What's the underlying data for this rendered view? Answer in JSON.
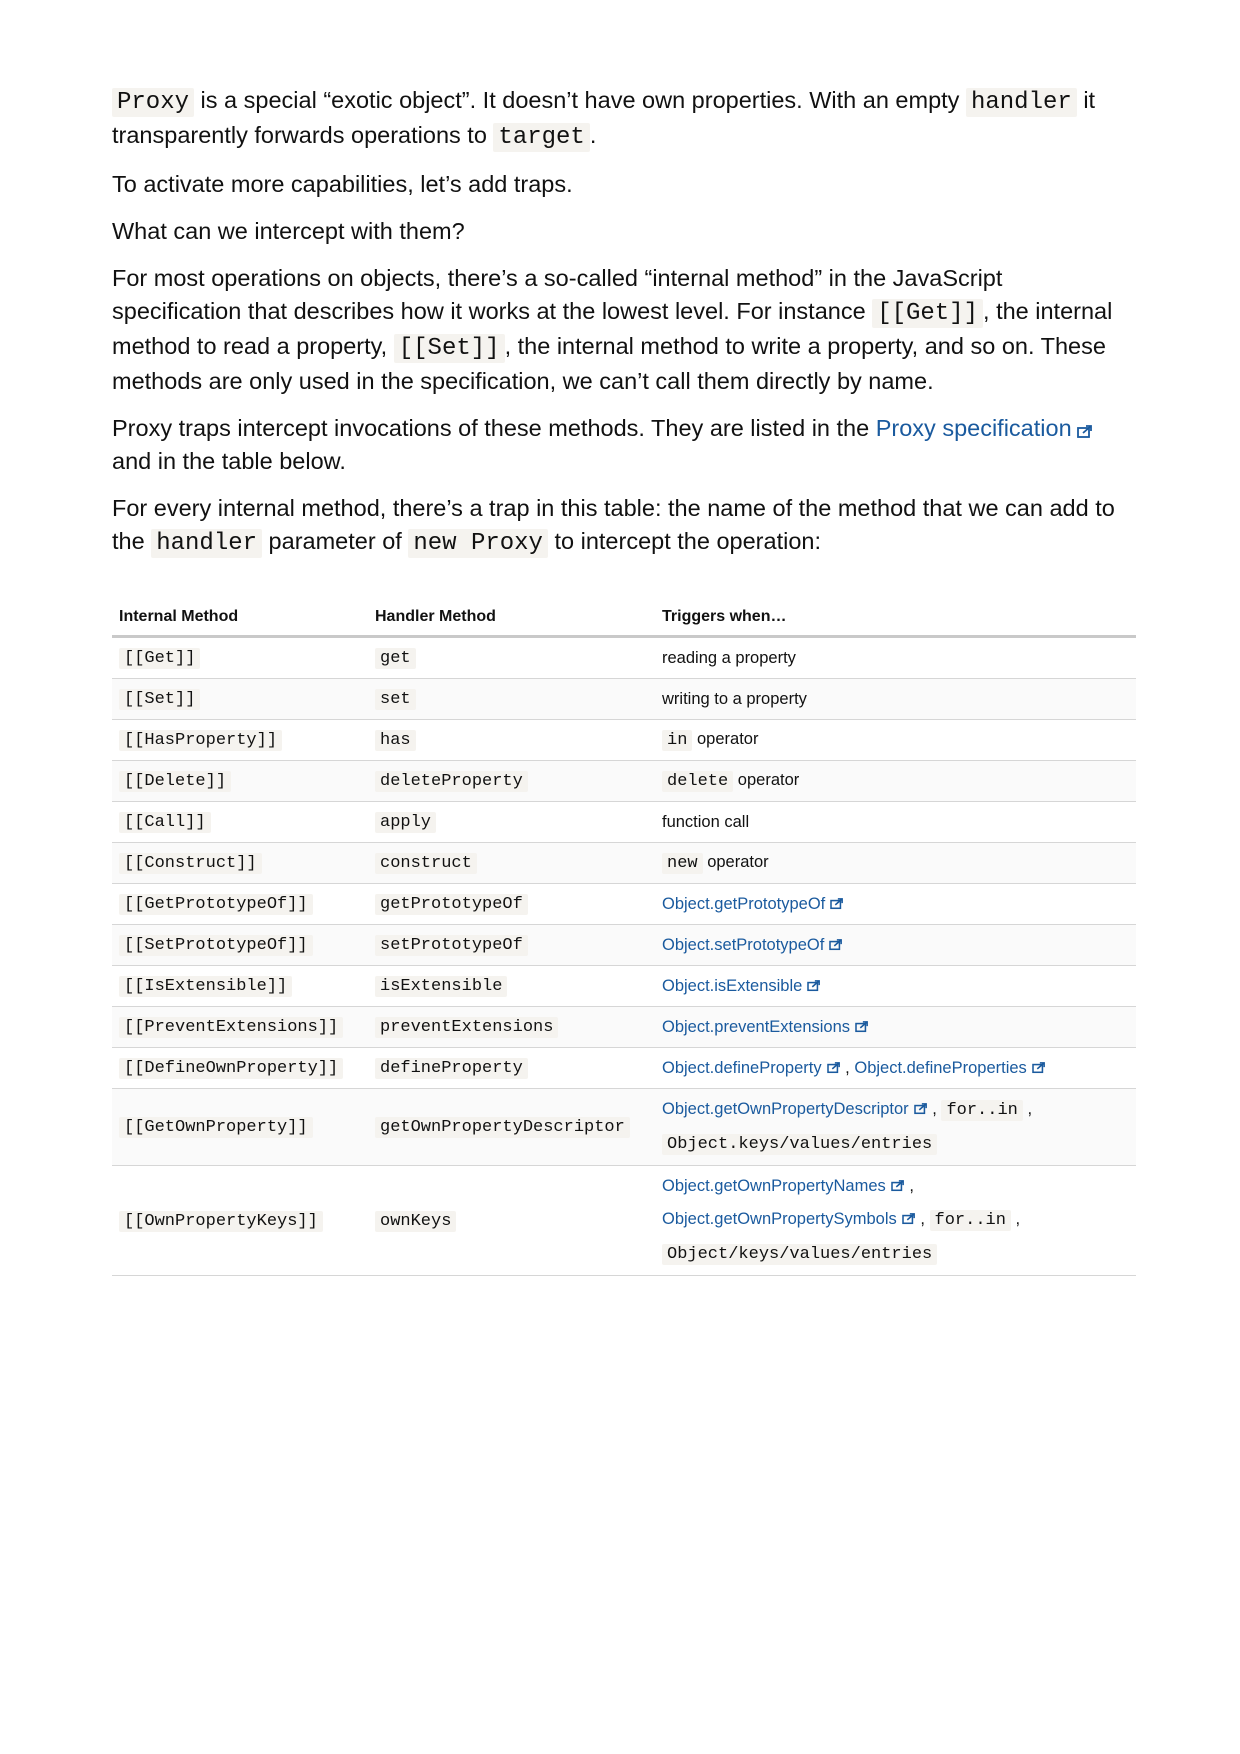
{
  "p1": {
    "c1": "Proxy",
    "t1": " is a special “exotic object”. It doesn’t have own properties. With an empty ",
    "c2": "handler",
    "t2": " it transparently forwards operations to ",
    "c3": "target",
    "t3": "."
  },
  "p2": "To activate more capabilities, let’s add traps.",
  "p3": "What can we intercept with them?",
  "p4": {
    "t1": "For most operations on objects, there’s a so-called “internal method” in the JavaScript specification that describes how it works at the lowest level. For instance ",
    "c1": "[[Get]]",
    "t2": ", the internal method to read a property, ",
    "c2": "[[Set]]",
    "t3": ", the internal method to write a property, and so on. These methods are only used in the specification, we can’t call them directly by name."
  },
  "p5": {
    "t1": "Proxy traps intercept invocations of these methods. They are listed in the ",
    "link": "Proxy specification",
    "t2": " and in the table below."
  },
  "p6": {
    "t1": "For every internal method, there’s a trap in this table: the name of the method that we can add to the ",
    "c1": "handler",
    "t2": " parameter of ",
    "c2": "new Proxy",
    "t3": " to intercept the operation:"
  },
  "table": {
    "headers": [
      "Internal Method",
      "Handler Method",
      "Triggers when…"
    ],
    "rows": [
      {
        "internal": "[[Get]]",
        "handler": "get",
        "trig_text": "reading a property"
      },
      {
        "internal": "[[Set]]",
        "handler": "set",
        "trig_text": "writing to a property"
      },
      {
        "internal": "[[HasProperty]]",
        "handler": "has",
        "trig_code": "in",
        "trig_text": " operator"
      },
      {
        "internal": "[[Delete]]",
        "handler": "deleteProperty",
        "trig_code": "delete",
        "trig_text": " operator"
      },
      {
        "internal": "[[Call]]",
        "handler": "apply",
        "trig_text": "function call"
      },
      {
        "internal": "[[Construct]]",
        "handler": "construct",
        "trig_code": "new",
        "trig_text": " operator"
      },
      {
        "internal": "[[GetPrototypeOf]]",
        "handler": "getPrototypeOf",
        "trig_link": "Object.getPrototypeOf"
      },
      {
        "internal": "[[SetPrototypeOf]]",
        "handler": "setPrototypeOf",
        "trig_link": "Object.setPrototypeOf"
      },
      {
        "internal": "[[IsExtensible]]",
        "handler": "isExtensible",
        "trig_link": "Object.isExtensible"
      },
      {
        "internal": "[[PreventExtensions]]",
        "handler": "preventExtensions",
        "trig_link": "Object.preventExtensions"
      },
      {
        "internal": "[[DefineOwnProperty]]",
        "handler": "defineProperty",
        "trig_link": "Object.defineProperty",
        "trig_link2": "Object.defineProperties"
      },
      {
        "internal": "[[GetOwnProperty]]",
        "handler": "getOwnPropertyDescriptor",
        "trig_link": "Object.getOwnPropertyDescriptor",
        "trig_code": "for..in",
        "trig_code2": "Object.keys/values/entries"
      },
      {
        "internal": "[[OwnPropertyKeys]]",
        "handler": "ownKeys",
        "trig_link": "Object.getOwnPropertyNames",
        "trig_link2": "Object.getOwnPropertySymbols",
        "trig_code": "for..in",
        "trig_code2": "Object/keys/values/entries"
      }
    ]
  },
  "colors": {
    "link": "#1a5a9e",
    "code_bg": "#f5f3ef",
    "text": "#111111"
  },
  "icons": {
    "external_link": "external-link-icon"
  }
}
